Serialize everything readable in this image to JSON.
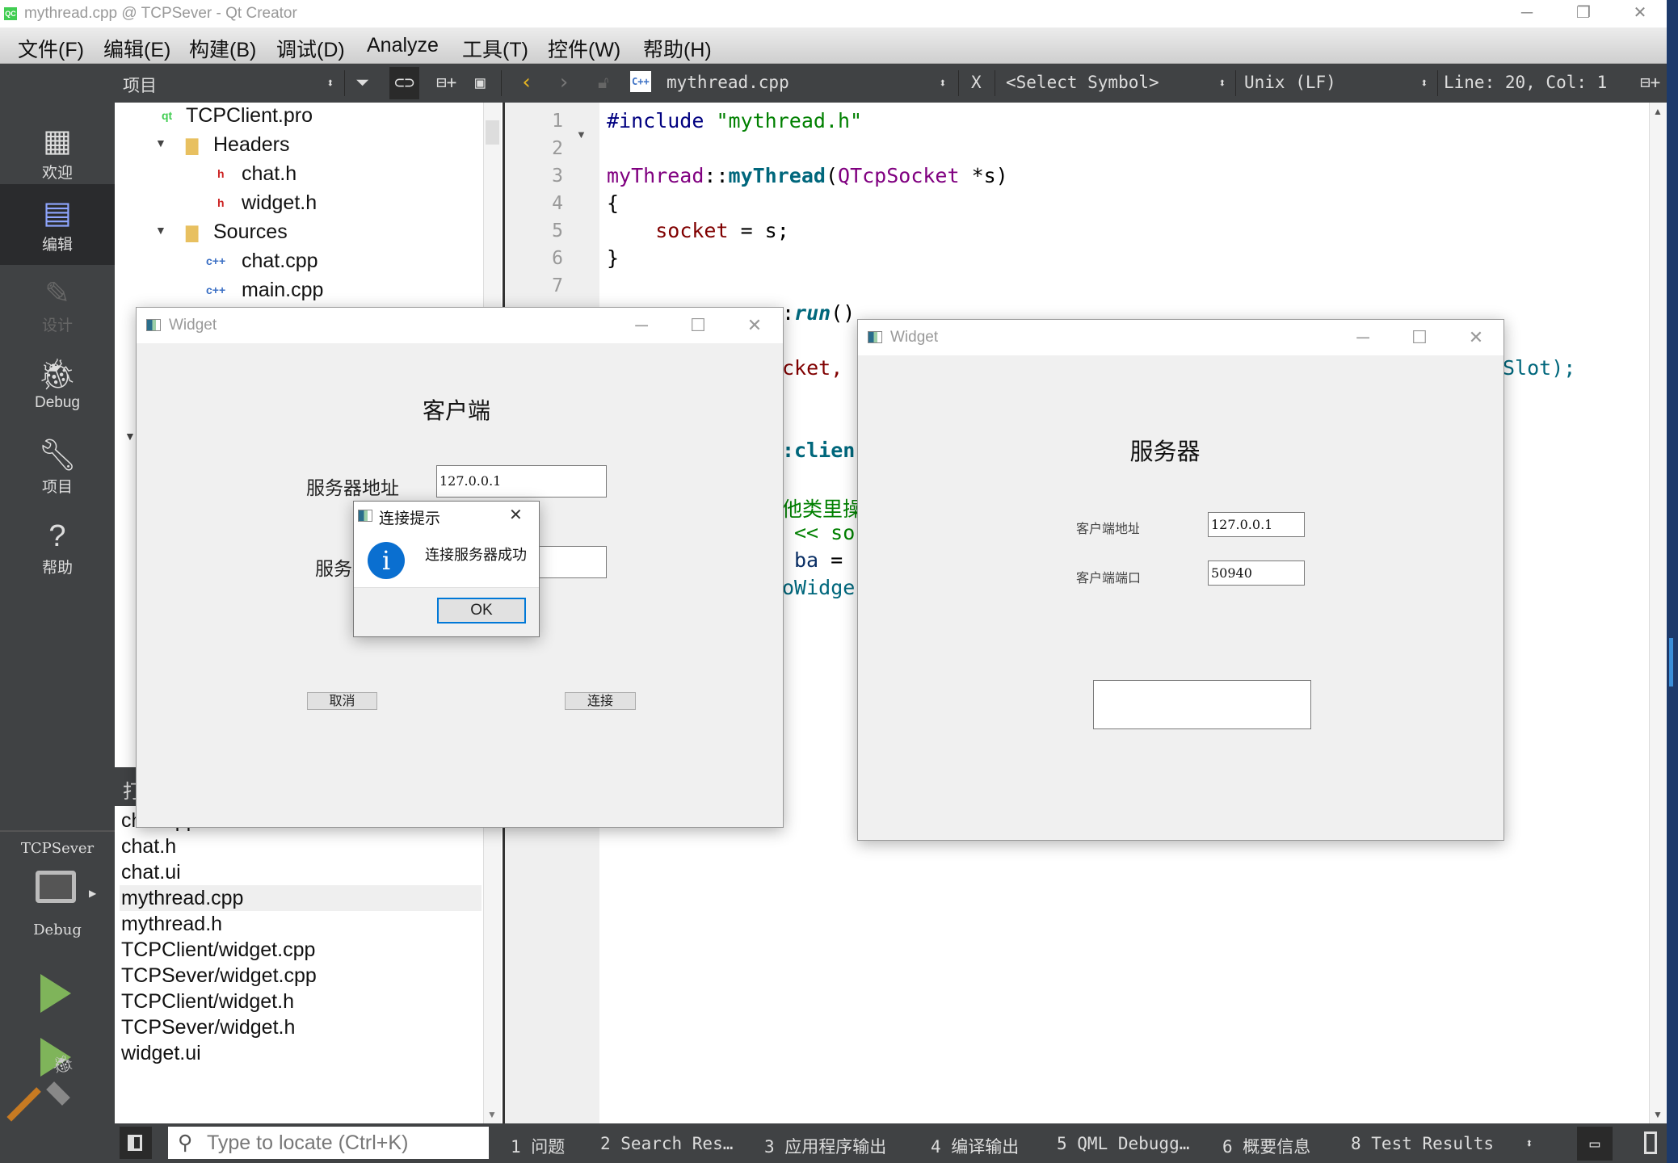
{
  "window": {
    "title": "mythread.cpp @ TCPSever - Qt Creator",
    "app_icon": "QC",
    "minimize": "─",
    "maximize": "❐",
    "close": "✕"
  },
  "menu": [
    "文件(F)",
    "编辑(E)",
    "构建(B)",
    "调试(D)",
    "Analyze",
    "工具(T)",
    "控件(W)",
    "帮助(H)"
  ],
  "toolbar": {
    "panel_title": "项目",
    "file_name": "mythread.cpp",
    "symbol": "<Select Symbol>",
    "line_ending": "Unix (LF)",
    "position": "Line: 20, Col: 1",
    "close": "X"
  },
  "modes": [
    {
      "label": "欢迎",
      "icon": "grid-icon"
    },
    {
      "label": "编辑",
      "icon": "edit-icon",
      "selected": true
    },
    {
      "label": "设计",
      "icon": "pen-icon",
      "disabled": true
    },
    {
      "label": "Debug",
      "icon": "bug-icon"
    },
    {
      "label": "项目",
      "icon": "wrench-icon"
    },
    {
      "label": "帮助",
      "icon": "help-icon"
    }
  ],
  "kit": {
    "project": "TCPSever",
    "build": "Debug"
  },
  "tree": [
    {
      "label": "TCPClient.pro",
      "icon": "qt-pro-icon"
    },
    {
      "label": "Headers",
      "icon": "folder-icon",
      "expanded": true
    },
    {
      "label": "chat.h",
      "icon": "header-file-icon"
    },
    {
      "label": "widget.h",
      "icon": "header-file-icon"
    },
    {
      "label": "Sources",
      "icon": "folder-icon",
      "expanded": true
    },
    {
      "label": "chat.cpp",
      "icon": "cpp-file-icon"
    },
    {
      "label": "main.cpp",
      "icon": "cpp-file-icon"
    }
  ],
  "open_docs": {
    "title": "打",
    "items": [
      "chat.cpp",
      "chat.h",
      "chat.ui",
      "mythread.cpp",
      "mythread.h",
      "TCPClient/widget.cpp",
      "TCPSever/widget.cpp",
      "TCPClient/widget.h",
      "TCPSever/widget.h",
      "widget.ui"
    ],
    "selected": "mythread.cpp"
  },
  "code": {
    "line_numbers": [
      "1",
      "2",
      "3",
      "4",
      "5",
      "6",
      "7"
    ],
    "lines": [
      [
        {
          "t": "#include ",
          "c": "c-pre"
        },
        {
          "t": "\"mythread.h\"",
          "c": "c-str"
        }
      ],
      [],
      [
        {
          "t": "myThread",
          "c": "c-type"
        },
        {
          "t": "::",
          "c": ""
        },
        {
          "t": "myThread",
          "c": "c-fn"
        },
        {
          "t": "(",
          "c": ""
        },
        {
          "t": "QTcpSocket",
          "c": "c-type"
        },
        {
          "t": " *s)",
          "c": ""
        }
      ],
      [
        {
          "t": "{",
          "c": ""
        }
      ],
      [
        {
          "t": "    ",
          "c": ""
        },
        {
          "t": "socket",
          "c": "c-mem"
        },
        {
          "t": " = s;",
          "c": ""
        }
      ],
      [
        {
          "t": "}",
          "c": ""
        }
      ],
      []
    ],
    "fragments": [
      ":",
      "run",
      "()",
      "cket,",
      "Slot);",
      ":clien",
      "他类里操",
      "<< so",
      "ba",
      "=",
      "oWidge"
    ]
  },
  "status": {
    "locate_placeholder": "Type to locate (Ctrl+K)",
    "tabs": [
      "1 问题",
      "2 Search Res…",
      "3 应用程序输出",
      "4 编译输出",
      "5 QML Debugg…",
      "6 概要信息",
      "8 Test Results"
    ]
  },
  "client_window": {
    "title": "Widget",
    "heading": "客户端",
    "address_label": "服务器地址",
    "address_value": "127.0.0.1",
    "port_label": "服务器端口",
    "port_value": "",
    "cancel": "取消",
    "connect": "连接"
  },
  "dialog": {
    "title": "连接提示",
    "message": "连接服务器成功",
    "ok": "OK",
    "icon": "info-icon",
    "close": "✕"
  },
  "server_window": {
    "title": "Widget",
    "heading": "服务器",
    "address_label": "客户端地址",
    "address_value": "127.0.0.1",
    "port_label": "客户端端口",
    "port_value": "50940",
    "message_box": ""
  }
}
